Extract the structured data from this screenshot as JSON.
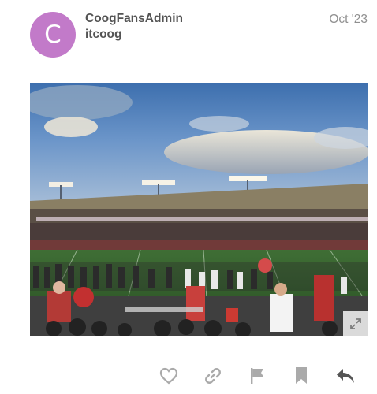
{
  "post": {
    "avatar_letter": "C",
    "avatar_color": "#c27ac9",
    "username": "CoogFansAdmin",
    "full_name": "itcoog",
    "date": "Oct '23"
  },
  "image": {
    "description_icon": "stadium-photo",
    "expand_icon": "expand-icon"
  },
  "actions": {
    "icons": [
      "heart-icon",
      "link-icon",
      "flag-icon",
      "bookmark-icon",
      "reply-icon"
    ],
    "icon_color": "#aaaaaa",
    "reply_color": "#555555"
  }
}
